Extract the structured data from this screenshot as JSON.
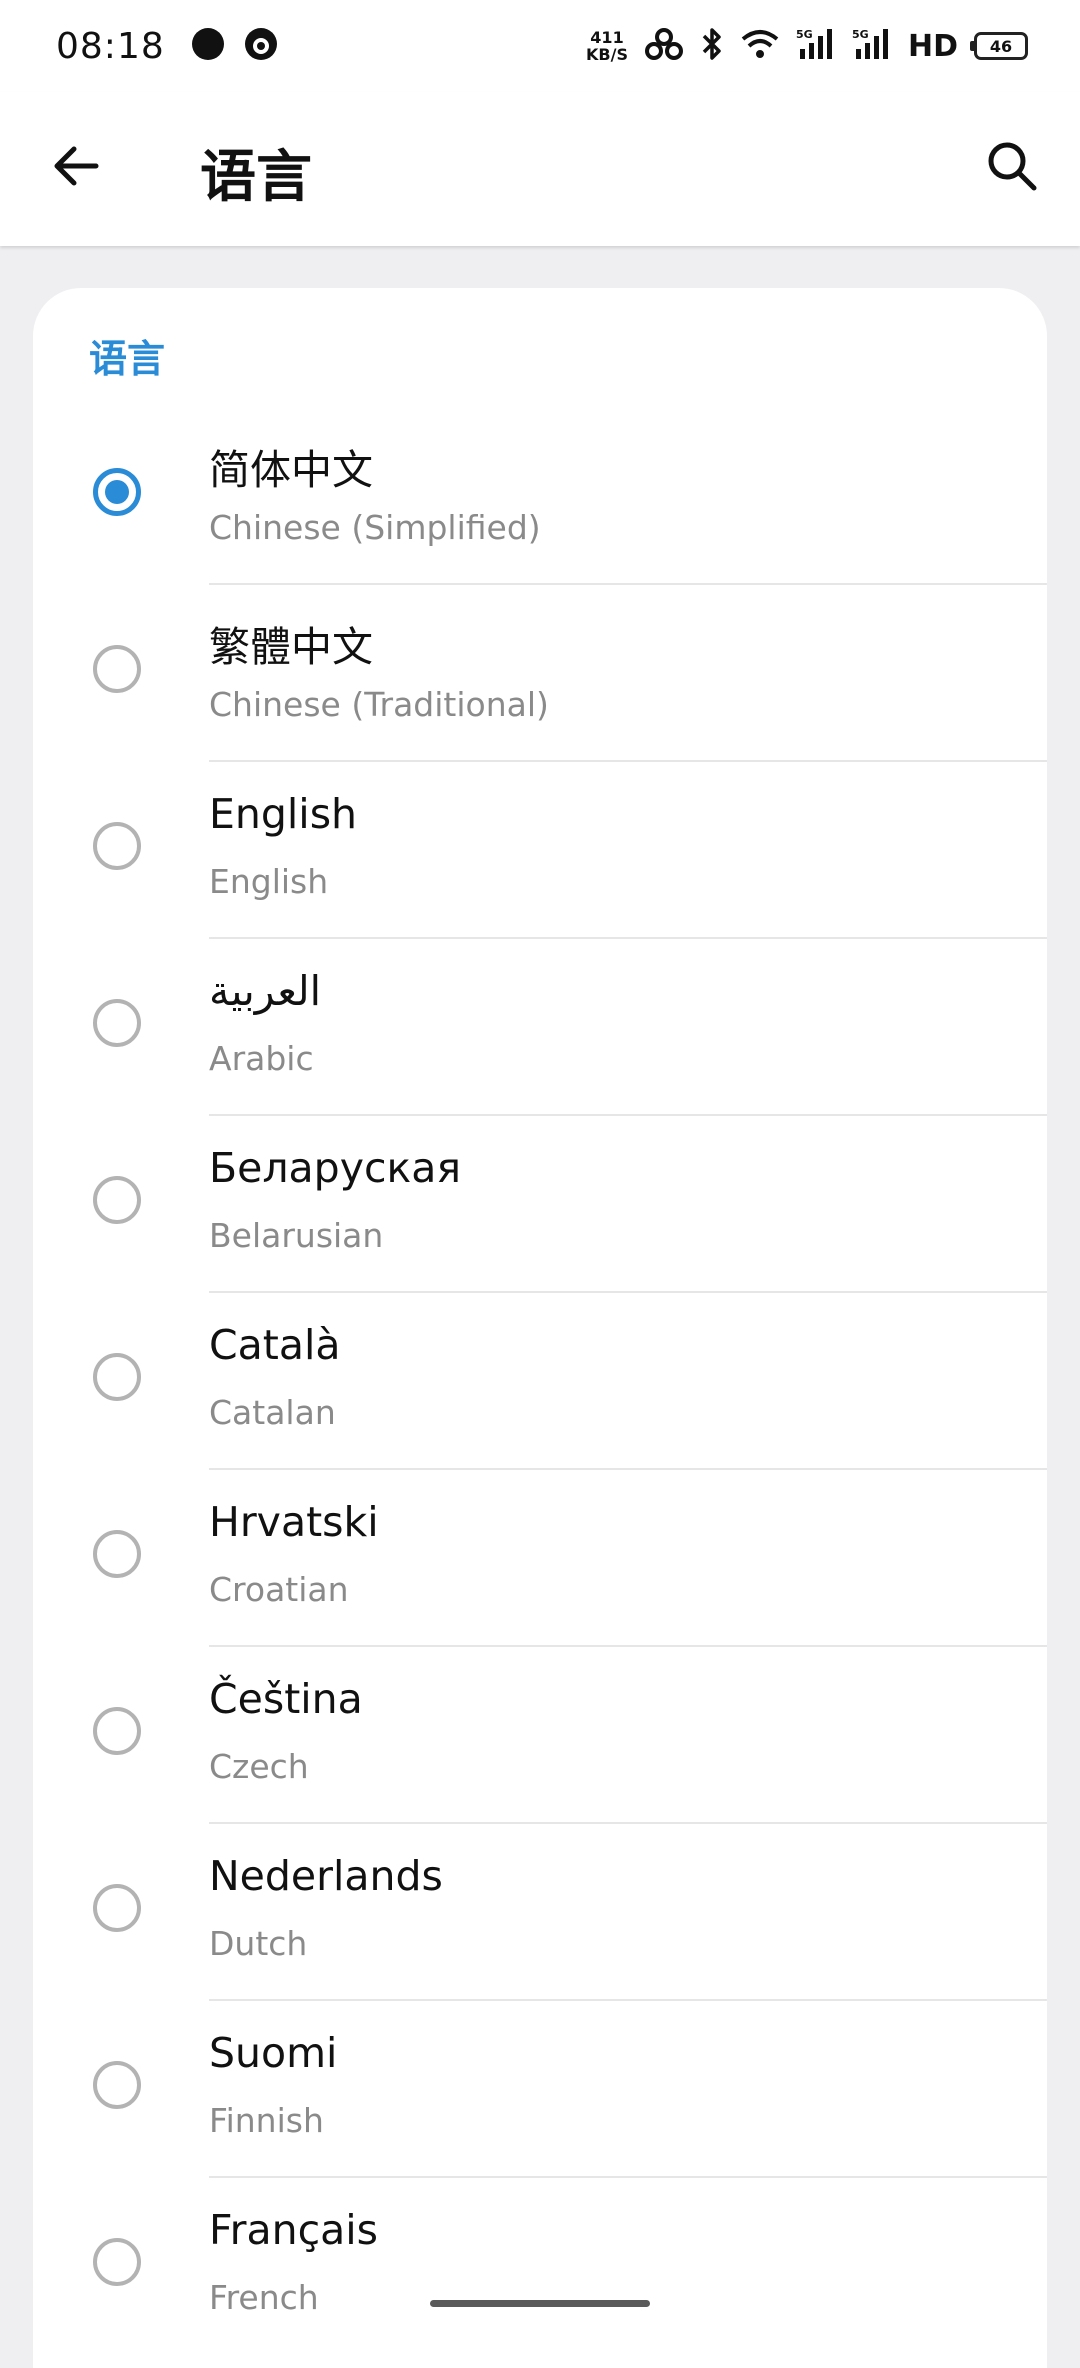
{
  "status_bar": {
    "time": "08:18",
    "net_speed_value": "411",
    "net_speed_unit": "KB/S",
    "hd": "HD",
    "battery": "46",
    "icons": [
      "notification-dot-icon",
      "app-circle-icon",
      "link-icon",
      "bluetooth-icon",
      "wifi-icon",
      "signal-5g-icon",
      "signal-5g-icon-2"
    ]
  },
  "app_bar": {
    "title": "语言",
    "back_icon": "arrow-left-icon",
    "search_icon": "search-icon"
  },
  "section": {
    "title": "语言"
  },
  "accent_color": "#2a8bd6",
  "languages": [
    {
      "native": "简体中文",
      "english": "Chinese (Simplified)",
      "selected": true
    },
    {
      "native": "繁體中文",
      "english": "Chinese (Traditional)",
      "selected": false
    },
    {
      "native": "English",
      "english": "English",
      "selected": false
    },
    {
      "native": "العربية",
      "english": "Arabic",
      "selected": false
    },
    {
      "native": "Беларуская",
      "english": "Belarusian",
      "selected": false
    },
    {
      "native": "Català",
      "english": "Catalan",
      "selected": false
    },
    {
      "native": "Hrvatski",
      "english": "Croatian",
      "selected": false
    },
    {
      "native": "Čeština",
      "english": "Czech",
      "selected": false
    },
    {
      "native": "Nederlands",
      "english": "Dutch",
      "selected": false
    },
    {
      "native": "Suomi",
      "english": "Finnish",
      "selected": false
    },
    {
      "native": "Français",
      "english": "French",
      "selected": false
    }
  ]
}
